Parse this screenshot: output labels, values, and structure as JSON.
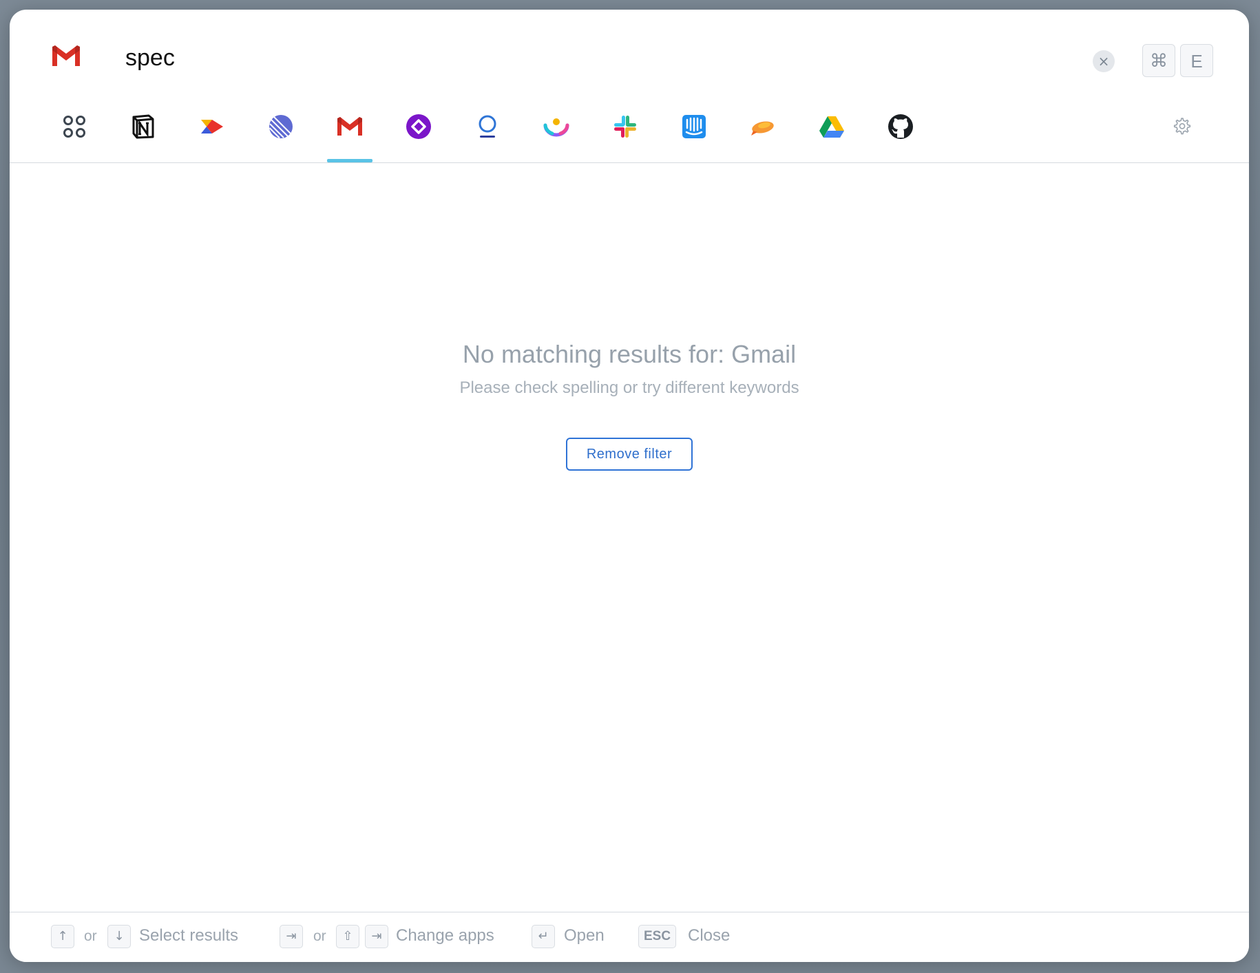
{
  "search": {
    "app_icon": "gmail-icon",
    "query": "spec",
    "clear_label": "×",
    "shortcut_keys": [
      "⌘",
      "E"
    ]
  },
  "tabs": [
    {
      "name": "all-apps",
      "icon": "grid-icon"
    },
    {
      "name": "notion",
      "icon": "notion-icon"
    },
    {
      "name": "productboard",
      "icon": "productboard-icon"
    },
    {
      "name": "linear",
      "icon": "linear-icon"
    },
    {
      "name": "gmail",
      "icon": "gmail-icon",
      "active": true
    },
    {
      "name": "clickup",
      "icon": "clickup-icon"
    },
    {
      "name": "loom",
      "icon": "loom-icon"
    },
    {
      "name": "height",
      "icon": "height-icon"
    },
    {
      "name": "slack",
      "icon": "slack-icon"
    },
    {
      "name": "intercom",
      "icon": "intercom-icon"
    },
    {
      "name": "zeplin",
      "icon": "zeplin-icon"
    },
    {
      "name": "google-drive",
      "icon": "google-drive-icon"
    },
    {
      "name": "github",
      "icon": "github-icon"
    }
  ],
  "empty_state": {
    "title": "No matching results for: Gmail",
    "subtitle": "Please check spelling or try different keywords",
    "button_label": "Remove filter"
  },
  "footer": {
    "or_label": "or",
    "select_keys": [
      "↑",
      "↓"
    ],
    "select_label": "Select results",
    "change_keys": [
      "⇥",
      "⇧",
      "⇥"
    ],
    "change_label": "Change apps",
    "open_key": "↵",
    "open_label": "Open",
    "close_key": "ESC",
    "close_label": "Close"
  },
  "colors": {
    "accent": "#5ac3e6",
    "button_border": "#2f73d6",
    "muted_text": "#97a1ab"
  }
}
